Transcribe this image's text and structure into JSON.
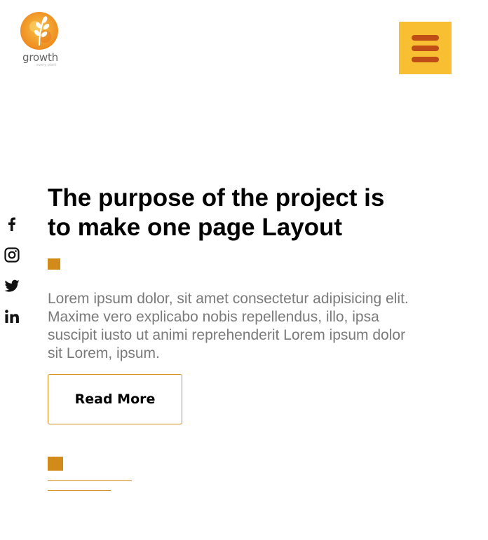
{
  "header": {
    "logo": {
      "name": "growth",
      "tagline": "every plant"
    },
    "menu_button": {
      "icon": "hamburger-menu-icon",
      "bg_color": "#f7bf31",
      "bar_color": "#c04d16"
    }
  },
  "social": {
    "items": [
      {
        "name": "facebook",
        "icon": "facebook-icon"
      },
      {
        "name": "instagram",
        "icon": "instagram-icon"
      },
      {
        "name": "twitter",
        "icon": "twitter-icon"
      },
      {
        "name": "linkedin",
        "icon": "linkedin-icon"
      }
    ]
  },
  "hero": {
    "title_line1": "The purpose of the project is",
    "title_line2": "to make one page Layout",
    "description": "Lorem ipsum dolor, sit amet consectetur adipisicing elit. Maxime vero explicabo nobis repellendus, illo, ipsa suscipit iusto ut animi reprehenderit Lorem ipsum dolor sit Lorem, ipsum.",
    "read_more_label": "Read More",
    "accent_color": "#d28a1b"
  }
}
